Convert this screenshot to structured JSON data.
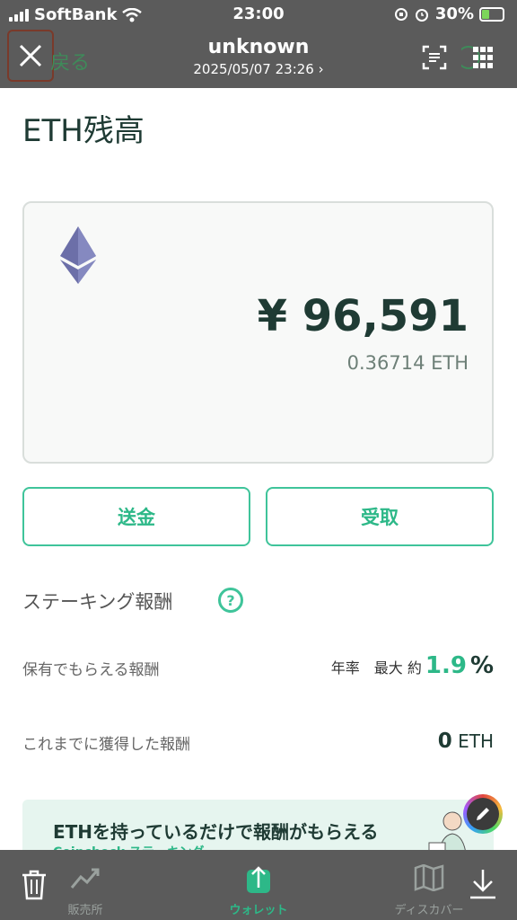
{
  "status_bar": {
    "carrier": "SoftBank",
    "time": "23:00",
    "battery": "30%"
  },
  "viewer": {
    "title": "unknown",
    "date": "2025/05/07 23:26 ›",
    "back_label": "戻る"
  },
  "page": {
    "title": "ETH残高"
  },
  "balance": {
    "jpy": "¥ 96,591",
    "eth": "0.36714 ETH"
  },
  "actions": {
    "send": "送金",
    "receive": "受取"
  },
  "staking": {
    "title": "ステーキング報酬",
    "help": "?",
    "reward_label": "保有でもらえる報酬",
    "reward_prefix": "年率　最大 約",
    "reward_rate": "1.9",
    "reward_unit": "%",
    "earned_label": "これまでに獲得した報酬",
    "earned_amount": "0",
    "earned_unit": "ETH"
  },
  "banner": {
    "text": "ETHを持っているだけで報酬がもらえる",
    "sub": "Coincheck ステーキング"
  },
  "bottom_nav": [
    {
      "label": "販売所",
      "icon": "chart-line-icon"
    },
    {
      "label": "ウォレット",
      "icon": "wallet-icon"
    },
    {
      "label": "ディスカバー",
      "icon": "map-icon"
    }
  ],
  "colors": {
    "accent": "#2db888",
    "text": "#1f3b34",
    "overlay": "#5b5b5b"
  }
}
